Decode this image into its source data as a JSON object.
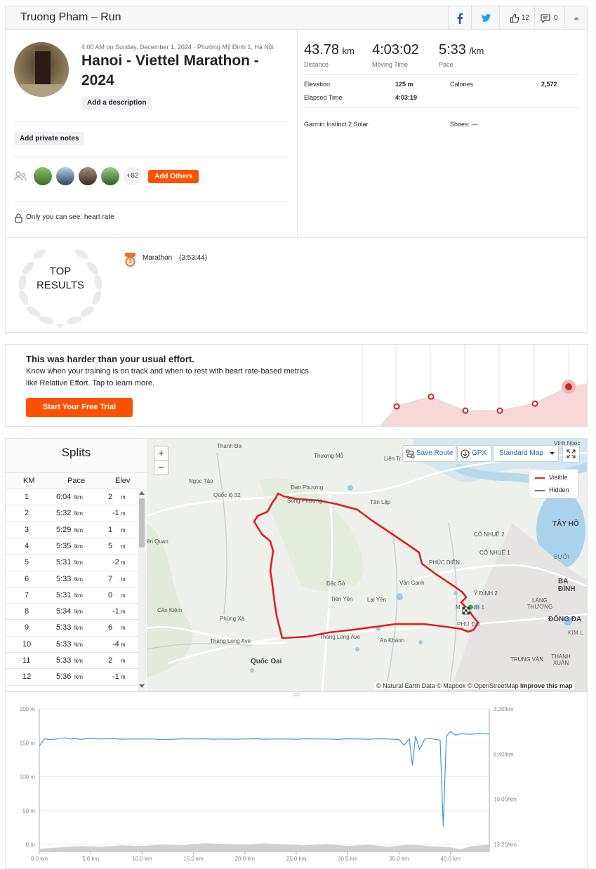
{
  "header": {
    "title": "Truong Pham – Run",
    "kudos_count": "12",
    "comment_count": "0"
  },
  "activity": {
    "datetime": "4:00 AM on Sunday, December 1, 2024 · Phường Mỹ Đình 1, Hà Nội",
    "title_line1": "Hanoi - Viettel Marathon -",
    "title_line2": "2024",
    "add_description": "Add a description",
    "add_private_notes": "Add private notes",
    "extra_athletes": "+82",
    "add_others": "Add Others",
    "privacy_note": "Only you can see: heart rate"
  },
  "stats": {
    "distance_value": "43.78",
    "distance_unit": "km",
    "distance_label": "Distance",
    "moving_time_value": "4:03:02",
    "moving_time_label": "Moving Time",
    "pace_value": "5:33",
    "pace_unit": "/km",
    "pace_label": "Pace",
    "elevation_label": "Elevation",
    "elevation_value": "125 m",
    "calories_label": "Calories",
    "calories_value": "2,572",
    "elapsed_label": "Elapsed Time",
    "elapsed_value": "4:03:19",
    "device": "Garmin Instinct 2 Solar",
    "shoes": "Shoes: —"
  },
  "results": {
    "top_line1": "TOP",
    "top_line2": "RESULTS",
    "badge_number": "3",
    "achievement": "Marathon",
    "achievement_time": "(3:53:44)"
  },
  "promo": {
    "heading": "This was harder than your usual effort.",
    "body_line1": "Know when your training is on track and when to rest with heart rate-based metrics",
    "body_line2": "like Relative Effort. Tap to learn more.",
    "cta": "Start Your Free Trial"
  },
  "splits": {
    "title": "Splits",
    "col_km": "KM",
    "col_pace": "Pace",
    "col_elev": "Elev",
    "pace_unit": "/km",
    "elev_unit": "m",
    "rows": [
      {
        "km": "1",
        "pace": "6:04",
        "elev": "2"
      },
      {
        "km": "2",
        "pace": "5:32",
        "elev": "-1"
      },
      {
        "km": "3",
        "pace": "5:29",
        "elev": "1"
      },
      {
        "km": "4",
        "pace": "5:35",
        "elev": "5"
      },
      {
        "km": "5",
        "pace": "5:31",
        "elev": "-2"
      },
      {
        "km": "6",
        "pace": "5:33",
        "elev": "7"
      },
      {
        "km": "7",
        "pace": "5:31",
        "elev": "0"
      },
      {
        "km": "8",
        "pace": "5:34",
        "elev": "-1"
      },
      {
        "km": "9",
        "pace": "5:33",
        "elev": "6"
      },
      {
        "km": "10",
        "pace": "5:33",
        "elev": "-4"
      },
      {
        "km": "11",
        "pace": "5:33",
        "elev": "2"
      },
      {
        "km": "12",
        "pace": "5:36",
        "elev": "-1"
      }
    ]
  },
  "map": {
    "zoom_in": "+",
    "zoom_out": "−",
    "save_route": "Save Route",
    "gpx": "GPX",
    "map_style": "Standard Map",
    "legend_visible": "Visible",
    "legend_hidden": "Hidden",
    "attribution_prefix": "© Natural Earth Data © Mapbox © OpenStreetMap",
    "attribution_link": "Improve this map",
    "route_color": "#e01e1e",
    "labels": [
      "Thanh Đa",
      "Thượng Mỗ",
      "Liên Tr...",
      "Vĩnh Ngọc",
      "Ngọc Tảo",
      "Quốc lộ 32",
      "Đan Phượng",
      "Song Phượng",
      "Tân Lập",
      "TH",
      "TÂY HỒ",
      "ên Quan",
      "CỔ NHUẾ 2",
      "CỔ NHUẾ 1",
      "BƯỞI",
      "PHÚC DIỄN",
      "BA ĐÌNH",
      "Đắc Sở",
      "Vân Canh",
      "Ỹ ĐÌNH 2",
      "Tiền Yên",
      "Lại Yên",
      "M",
      "NH 1",
      "LÁNG THƯỢNG",
      "Cần Kiệm",
      "Phùng Xá",
      "PHÚ ĐÔ",
      "ĐỐNG ĐA",
      "KIM L",
      "Thang Long Ave",
      "Thăng Long Ave",
      "An Khánh",
      "Quốc Oai",
      "TRUNG VĂN",
      "THANH XUÂN"
    ]
  },
  "chart_data": {
    "type": "line",
    "xlabel": "",
    "ylabel": "",
    "x_ticks": [
      "0.0 km",
      "5.0 km",
      "10.0 km",
      "15.0 km",
      "20.0 km",
      "25.0 km",
      "30.0 km",
      "35.0 km",
      "40.0 km"
    ],
    "left_ticks": [
      "200 m",
      "150 m",
      "100 m",
      "50 m",
      "0 m"
    ],
    "right_ticks": [
      "3:20/km",
      "6:40/km",
      "10:00/km",
      "13:20/km"
    ],
    "xlim": [
      0,
      43.78
    ],
    "elevation_ylim": [
      0,
      200
    ],
    "series": [
      {
        "name": "",
        "kind": "pace",
        "color": "#3d9bd5",
        "unit": "seconds per km",
        "x": [
          0,
          0.5,
          1,
          1.5,
          2,
          2.5,
          3,
          3.5,
          4,
          4.5,
          5,
          6,
          7,
          8,
          9,
          10,
          11,
          12,
          13,
          14,
          15,
          16,
          17,
          18,
          19,
          20,
          21,
          22,
          23,
          24,
          25,
          26,
          27,
          28,
          29,
          30,
          31,
          32,
          33,
          34,
          35,
          35.5,
          36,
          36.3,
          36.6,
          37,
          37.5,
          38,
          38.5,
          39,
          39.3,
          39.6,
          40,
          40.5,
          41,
          42,
          43,
          43.78
        ],
        "y": [
          364,
          332,
          336,
          334,
          330,
          328,
          333,
          331,
          335,
          332,
          331,
          333,
          331,
          334,
          333,
          333,
          333,
          336,
          334,
          332,
          333,
          332,
          334,
          333,
          334,
          333,
          332,
          334,
          333,
          333,
          334,
          332,
          333,
          333,
          335,
          332,
          333,
          334,
          332,
          333,
          336,
          360,
          332,
          450,
          320,
          380,
          333,
          330,
          335,
          338,
          720,
          320,
          300,
          316,
          310,
          312,
          308,
          312
        ]
      },
      {
        "name": "",
        "kind": "elevation",
        "color": "#c8c8c8",
        "unit": "m",
        "x": [
          0,
          2,
          4,
          6,
          8,
          10,
          12,
          14,
          16,
          18,
          20,
          22,
          24,
          26,
          28,
          30,
          32,
          34,
          36,
          38,
          40,
          41,
          42,
          43,
          43.78
        ],
        "y": [
          4,
          6,
          8,
          7,
          9,
          8,
          10,
          9,
          12,
          11,
          10,
          12,
          10,
          9,
          11,
          8,
          10,
          7,
          10,
          8,
          6,
          3,
          8,
          9,
          10
        ]
      }
    ]
  }
}
